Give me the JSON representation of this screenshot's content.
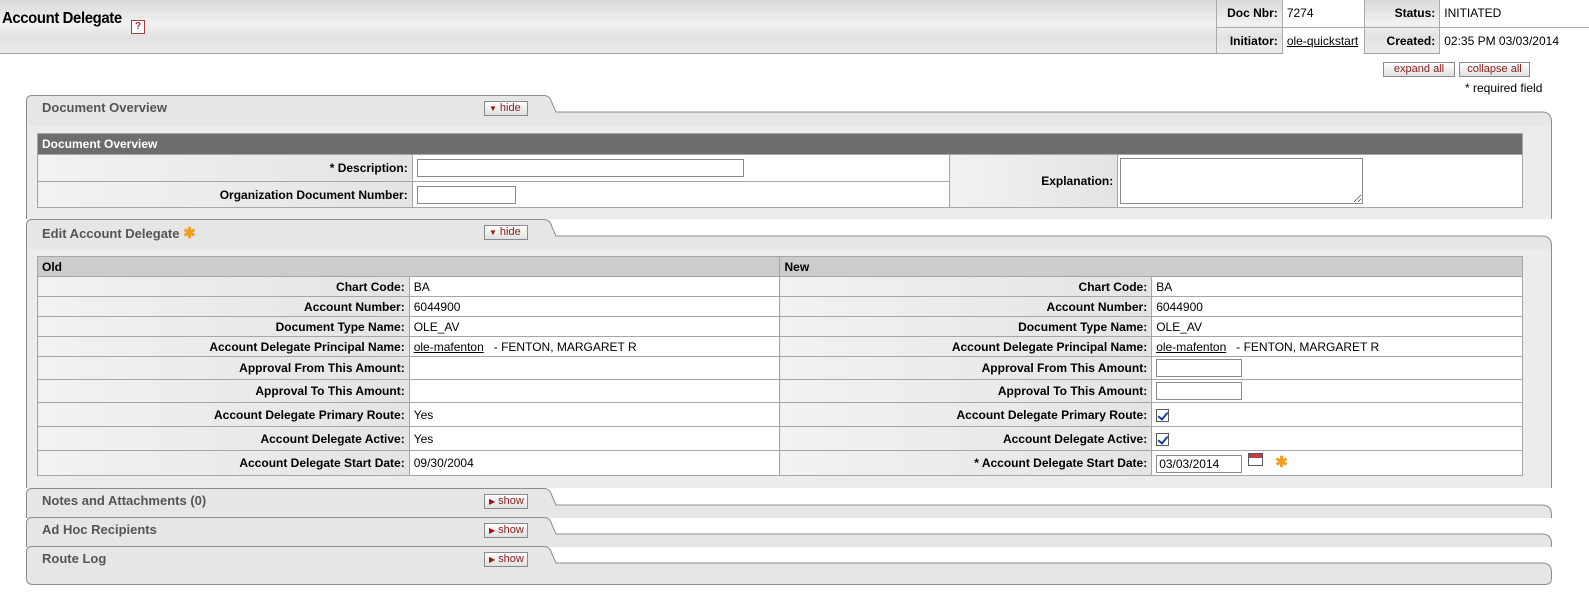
{
  "header": {
    "title": "Account Delegate",
    "help_icon": "?",
    "doc_nbr_label": "Doc Nbr:",
    "doc_nbr": "7274",
    "status_label": "Status:",
    "status": "INITIATED",
    "initiator_label": "Initiator:",
    "initiator": "ole-quickstart",
    "created_label": "Created:",
    "created": "02:35 PM 03/03/2014"
  },
  "toolbar": {
    "expand_all": "expand all",
    "collapse_all": "collapse all",
    "required_note": "* required field"
  },
  "tabs": {
    "doc_overview": {
      "title": "Document Overview",
      "button": "hide"
    },
    "edit_delegate": {
      "title": "Edit Account Delegate",
      "button": "hide"
    },
    "notes": {
      "title": "Notes and Attachments (0)",
      "button": "show"
    },
    "adhoc": {
      "title": "Ad Hoc Recipients",
      "button": "show"
    },
    "route_log": {
      "title": "Route Log",
      "button": "show"
    }
  },
  "overview": {
    "section_title": "Document Overview",
    "description_label": "* Description:",
    "description_value": "",
    "org_doc_label": "Organization Document Number:",
    "org_doc_value": "",
    "explanation_label": "Explanation:",
    "explanation_value": ""
  },
  "delegate": {
    "old_header": "Old",
    "new_header": "New",
    "labels": {
      "chart_code": "Chart Code:",
      "account_number": "Account Number:",
      "doc_type": "Document Type Name:",
      "principal": "Account Delegate Principal Name:",
      "approval_from": "Approval From This Amount:",
      "approval_to": "Approval To This Amount:",
      "primary_route": "Account Delegate Primary Route:",
      "active": "Account Delegate Active:",
      "start_date": "Account Delegate Start Date:",
      "start_date_required": "*  Account Delegate Start Date:"
    },
    "old": {
      "chart_code": "BA",
      "account_number": "6044900",
      "doc_type": "OLE_AV",
      "principal_id": "ole-mafenton",
      "principal_name": " - FENTON, MARGARET R",
      "approval_from": "",
      "approval_to": "",
      "primary_route": "Yes",
      "active": "Yes",
      "start_date": "09/30/2004"
    },
    "new": {
      "chart_code": "BA",
      "account_number": "6044900",
      "doc_type": "OLE_AV",
      "principal_id": "ole-mafenton",
      "principal_name": " - FENTON, MARGARET R",
      "approval_from": "",
      "approval_to": "",
      "primary_route": true,
      "active": true,
      "start_date": "03/03/2014"
    }
  }
}
